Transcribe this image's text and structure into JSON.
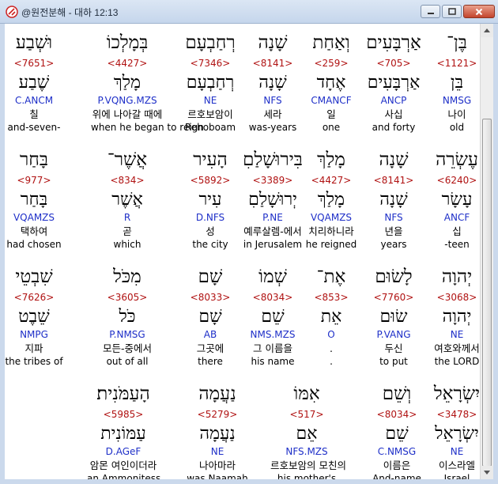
{
  "window": {
    "title": "@원전분해 - 대하 12:13"
  },
  "rows": [
    [
      {
        "heb": "בֶּן־",
        "strong": "<1121>",
        "lemma": "בֵּן",
        "morph": "NMSG",
        "kor": "나이",
        "eng": "old"
      },
      {
        "heb": "אַרְבָּעִים",
        "strong": "<705>",
        "lemma": "אַרְבָּעִים",
        "morph": "ANCP",
        "kor": "사십",
        "eng": "and forty"
      },
      {
        "heb": "וְאַחַת",
        "strong": "<259>",
        "lemma": "אֶחָד",
        "morph": "CMANCF",
        "kor": "일",
        "eng": "one"
      },
      {
        "heb": "שָׁנָה",
        "strong": "<8141>",
        "lemma": "שָׁנָה",
        "morph": "NFS",
        "kor": "세라",
        "eng": "was-years"
      },
      {
        "heb": "רְחַבְעָם",
        "strong": "<7346>",
        "lemma": "רְחַבְעָם",
        "morph": "NE",
        "kor": "르호보암이",
        "eng": "Rehoboam"
      },
      {
        "heb": "בְּמָלְכוֹ",
        "strong": "<4427>",
        "lemma": "מָלַךְ",
        "morph": "P.VQNG.MZS",
        "kor": "위에 나아갈 때에",
        "eng": "when he began to reign"
      },
      {
        "heb": "וּשְׁבַע",
        "strong": "<7651>",
        "lemma": "שֶׁבַע",
        "morph": "C.ANCM",
        "kor": "칠",
        "eng": "and-seven-"
      }
    ],
    [
      {
        "heb": "עֶשְׂרֵה",
        "strong": "<6240>",
        "lemma": "עָשָׂר",
        "morph": "ANCF",
        "kor": "십",
        "eng": "-teen"
      },
      {
        "heb": "שָׁנָה",
        "strong": "<8141>",
        "lemma": "שָׁנָה",
        "morph": "NFS",
        "kor": "년을",
        "eng": "years"
      },
      {
        "heb": "מָלַךְ",
        "strong": "<4427>",
        "lemma": "מָלַךְ",
        "morph": "VQAMZS",
        "kor": "치리하니라",
        "eng": "he reigned"
      },
      {
        "heb": "בִּירוּשָׁלַםִ",
        "strong": "<3389>",
        "lemma": "יְרוּשָׁלַםִ",
        "morph": "P.NE",
        "kor": "예루살렘-에서",
        "eng": "in Jerusalem"
      },
      {
        "heb": "הָעִיר",
        "strong": "<5892>",
        "lemma": "עִיר",
        "morph": "D.NFS",
        "kor": "성",
        "eng": "the city"
      },
      {
        "heb": "אֲשֶׁר־",
        "strong": "<834>",
        "lemma": "אֲשֶׁר",
        "morph": "R",
        "kor": "곧",
        "eng": "which"
      },
      {
        "heb": "בָּחַר",
        "strong": "<977>",
        "lemma": "בָּחַר",
        "morph": "VQAMZS",
        "kor": "택하여",
        "eng": "had chosen"
      }
    ],
    [
      {
        "heb": "יְהוָה",
        "strong": "<3068>",
        "lemma": "יְהוָה",
        "morph": "NE",
        "kor": "여호와께서",
        "eng": "the LORD"
      },
      {
        "heb": "לָשׂוּם",
        "strong": "<7760>",
        "lemma": "שׂוּם",
        "morph": "P.VANG",
        "kor": "두신",
        "eng": "to put"
      },
      {
        "heb": "אֶת־",
        "strong": "<853>",
        "lemma": "אֵת",
        "morph": "O",
        "kor": ".",
        "eng": "."
      },
      {
        "heb": "שְׁמוֹ",
        "strong": "<8034>",
        "lemma": "שֵׁם",
        "morph": "NMS.MZS",
        "kor": "그 이름을",
        "eng": "his name"
      },
      {
        "heb": "שָׁם",
        "strong": "<8033>",
        "lemma": "שָׁם",
        "morph": "AB",
        "kor": "그곳에",
        "eng": "there"
      },
      {
        "heb": "מִכֹּל",
        "strong": "<3605>",
        "lemma": "כֹּל",
        "morph": "P.NMSG",
        "kor": "모든-중에서",
        "eng": "out of all"
      },
      {
        "heb": "שִׁבְטֵי",
        "strong": "<7626>",
        "lemma": "שֵׁבֶט",
        "morph": "NMPG",
        "kor": "지파",
        "eng": "the tribes of"
      }
    ],
    [
      {
        "heb": "יִשְׂרָאֵל",
        "strong": "<3478>",
        "lemma": "יִשְׂרָאֵל",
        "morph": "NE",
        "kor": "이스라엘",
        "eng": "Israel"
      },
      {
        "heb": "וְשֵׁם",
        "strong": "<8034>",
        "lemma": "שֵׁם",
        "morph": "C.NMSG",
        "kor": "이름은",
        "eng": "And-name"
      },
      {
        "heb": "אִמּוֹ",
        "strong": "<517>",
        "lemma": "אֵם",
        "morph": "NFS.MZS",
        "kor": "르호보암의 모친의",
        "eng": "his mother's"
      },
      {
        "heb": "נַעֲמָה",
        "strong": "<5279>",
        "lemma": "נַעֲמָה",
        "morph": "NE",
        "kor": "나아마라",
        "eng": "was Naamah"
      },
      {
        "heb": "הָעַמֹּנִית׃",
        "strong": "<5985>",
        "lemma": "עַמּוֹנִית",
        "morph": "D.AGeF",
        "kor": "암몬 여인이더라",
        "eng": "an Ammonitess"
      }
    ]
  ]
}
